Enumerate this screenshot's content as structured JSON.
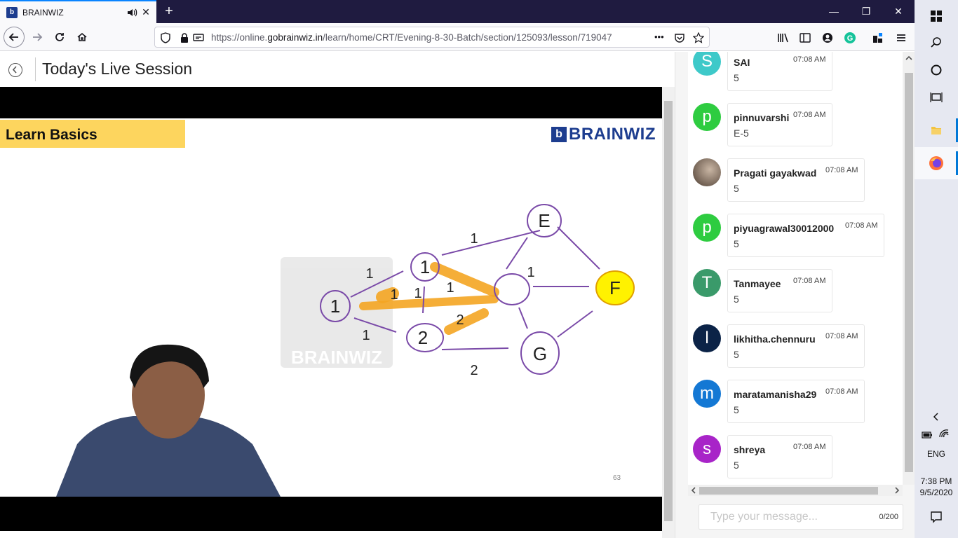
{
  "browser": {
    "tab_title": "BRAINWIZ",
    "url_prefix": "https://online.",
    "url_domain": "gobrainwiz.in",
    "url_path": "/learn/home/CRT/Evening-8-30-Batch/section/125093/lesson/719047",
    "more_label": "•••"
  },
  "page": {
    "title": "Today's Live Session"
  },
  "slide": {
    "heading": "Learn Basics",
    "brand_mark": "b",
    "brand_word": "BRAINWIZ",
    "page_number": "63",
    "nodes": [
      "1",
      "1",
      "2",
      "E",
      "F",
      "G"
    ],
    "edge_labels": [
      "1",
      "1",
      "1",
      "1",
      "1",
      "1",
      "2",
      "2",
      "1",
      "1"
    ]
  },
  "chat": {
    "messages": [
      {
        "initial": "S",
        "name": "SAI",
        "time": "07:08 AM",
        "text": "5",
        "color": "#3ec9c9"
      },
      {
        "initial": "p",
        "name": "pinnuvarshi",
        "time": "07:08 AM",
        "text": "E-5",
        "color": "#2ecc40"
      },
      {
        "initial": "",
        "name": "Pragati gayakwad",
        "time": "07:08 AM",
        "text": "5",
        "color": "#6b5a4e"
      },
      {
        "initial": "p",
        "name": "piyuagrawal30012000",
        "time": "07:08 AM",
        "text": "5",
        "color": "#2ecc40"
      },
      {
        "initial": "T",
        "name": "Tanmayee",
        "time": "07:08 AM",
        "text": "5",
        "color": "#3a9a6a"
      },
      {
        "initial": "l",
        "name": "likhitha.chennuru",
        "time": "07:08 AM",
        "text": "5",
        "color": "#0b2347"
      },
      {
        "initial": "m",
        "name": "maratamanisha29",
        "time": "07:08 AM",
        "text": "5",
        "color": "#1478d4"
      },
      {
        "initial": "s",
        "name": "shreya",
        "time": "07:08 AM",
        "text": "5",
        "color": "#a824c8"
      }
    ],
    "input_placeholder": "Type your message...",
    "char_count": "0/200"
  },
  "taskbar": {
    "language": "ENG",
    "time": "7:38 PM",
    "date": "9/5/2020"
  }
}
